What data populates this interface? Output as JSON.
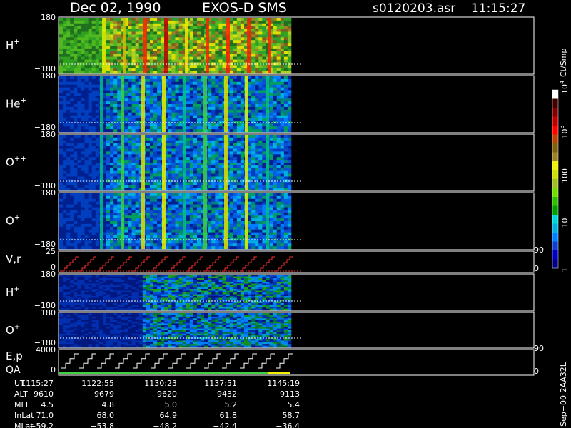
{
  "header": {
    "date": "Dec 02, 1990",
    "instrument": "EXOS-D SMS",
    "file": "s0120203.asr",
    "time": "11:15:27"
  },
  "colorbar": {
    "unit": "Ct/Smp",
    "tick_labels": [
      "10",
      "100",
      "1",
      "10",
      "10",
      "1"
    ],
    "ticks": [
      {
        "label": "1",
        "exp": ""
      },
      {
        "label": "10",
        "exp": ""
      },
      {
        "label": "100",
        "exp": ""
      },
      {
        "label": "10",
        "exp": "3"
      },
      {
        "label": "10",
        "exp": "4"
      }
    ],
    "colors": [
      "#000080",
      "#0000c0",
      "#1040d0",
      "#0080ff",
      "#00b0e0",
      "#00d8d8",
      "#00a000",
      "#30c000",
      "#70e000",
      "#a0c020",
      "#d0e000",
      "#f0f000",
      "#a08020",
      "#806010",
      "#c04000",
      "#ff0000",
      "#c00000",
      "#800000",
      "#400000",
      "#ffffff"
    ]
  },
  "panels": [
    {
      "id": "hplus-1",
      "label": "H",
      "sup": "+",
      "ytop": "180",
      "ybot": "−180",
      "kind": "spectrogram",
      "palette": "warm"
    },
    {
      "id": "heplus",
      "label": "He",
      "sup": "+",
      "ytop": "180",
      "ybot": "−180",
      "kind": "spectrogram",
      "palette": "blue"
    },
    {
      "id": "oplusplus",
      "label": "O",
      "sup": "++",
      "ytop": "180",
      "ybot": "−180",
      "kind": "spectrogram",
      "palette": "blue"
    },
    {
      "id": "oplus-1",
      "label": "O",
      "sup": "+",
      "ytop": "180",
      "ybot": "−180",
      "kind": "spectrogram",
      "palette": "blue"
    },
    {
      "id": "vr",
      "label": "V,r",
      "sup": "",
      "ytop": "25",
      "ybot": "0",
      "kind": "sweep",
      "right_top": "90",
      "right_bot": "0"
    },
    {
      "id": "hplus-2",
      "label": "H",
      "sup": "+",
      "ytop": "180",
      "ybot": "−180",
      "kind": "spectrogram",
      "palette": "blue2"
    },
    {
      "id": "oplus-2",
      "label": "O",
      "sup": "+",
      "ytop": "180",
      "ybot": "−180",
      "kind": "spectrogram",
      "palette": "blue3"
    },
    {
      "id": "ep",
      "label": "E,p",
      "label2": "QA",
      "sup": "",
      "ytop": "4000",
      "ybot": "0",
      "kind": "steps",
      "right_top": "90",
      "right_bot": "0"
    }
  ],
  "orbit": {
    "rows": [
      {
        "name": "UT",
        "values": [
          "1115:27",
          "1122:55",
          "1130:23",
          "1137:51",
          "1145:19"
        ]
      },
      {
        "name": "ALT",
        "values": [
          "9610",
          "9679",
          "9620",
          "9432",
          "9113"
        ]
      },
      {
        "name": "MLT",
        "values": [
          "4.5",
          "4.8",
          "5.0",
          "5.2",
          "5.4"
        ]
      },
      {
        "name": "InLat",
        "values": [
          "71.0",
          "68.0",
          "64.9",
          "61.8",
          "58.7"
        ]
      },
      {
        "name": "MLat",
        "values": [
          "−59.2",
          "−53.8",
          "−48.2",
          "−42.4",
          "−36.4"
        ]
      }
    ]
  },
  "footer": {
    "stamp": "Sep−00 2AA32L"
  },
  "chart_data": {
    "type": "heatmap",
    "title": "Dec 02, 1990   EXOS-D SMS",
    "x": {
      "label": "UT",
      "ticks": [
        "1115:27",
        "1122:55",
        "1130:23",
        "1137:51",
        "1145:19"
      ]
    },
    "series": [
      {
        "name": "H+",
        "ylim": [
          -180,
          180
        ]
      },
      {
        "name": "He+",
        "ylim": [
          -180,
          180
        ]
      },
      {
        "name": "O++",
        "ylim": [
          -180,
          180
        ]
      },
      {
        "name": "O+",
        "ylim": [
          -180,
          180
        ]
      },
      {
        "name": "V,r",
        "ylim": [
          0,
          25
        ]
      },
      {
        "name": "H+",
        "ylim": [
          -180,
          180
        ]
      },
      {
        "name": "O+",
        "ylim": [
          -180,
          180
        ]
      },
      {
        "name": "E,p",
        "ylim": [
          0,
          4000
        ]
      }
    ],
    "colorbar": {
      "unit": "Ct/Smp",
      "scale": "log",
      "range": [
        1,
        10000
      ]
    },
    "grid": false,
    "legend": "right"
  }
}
